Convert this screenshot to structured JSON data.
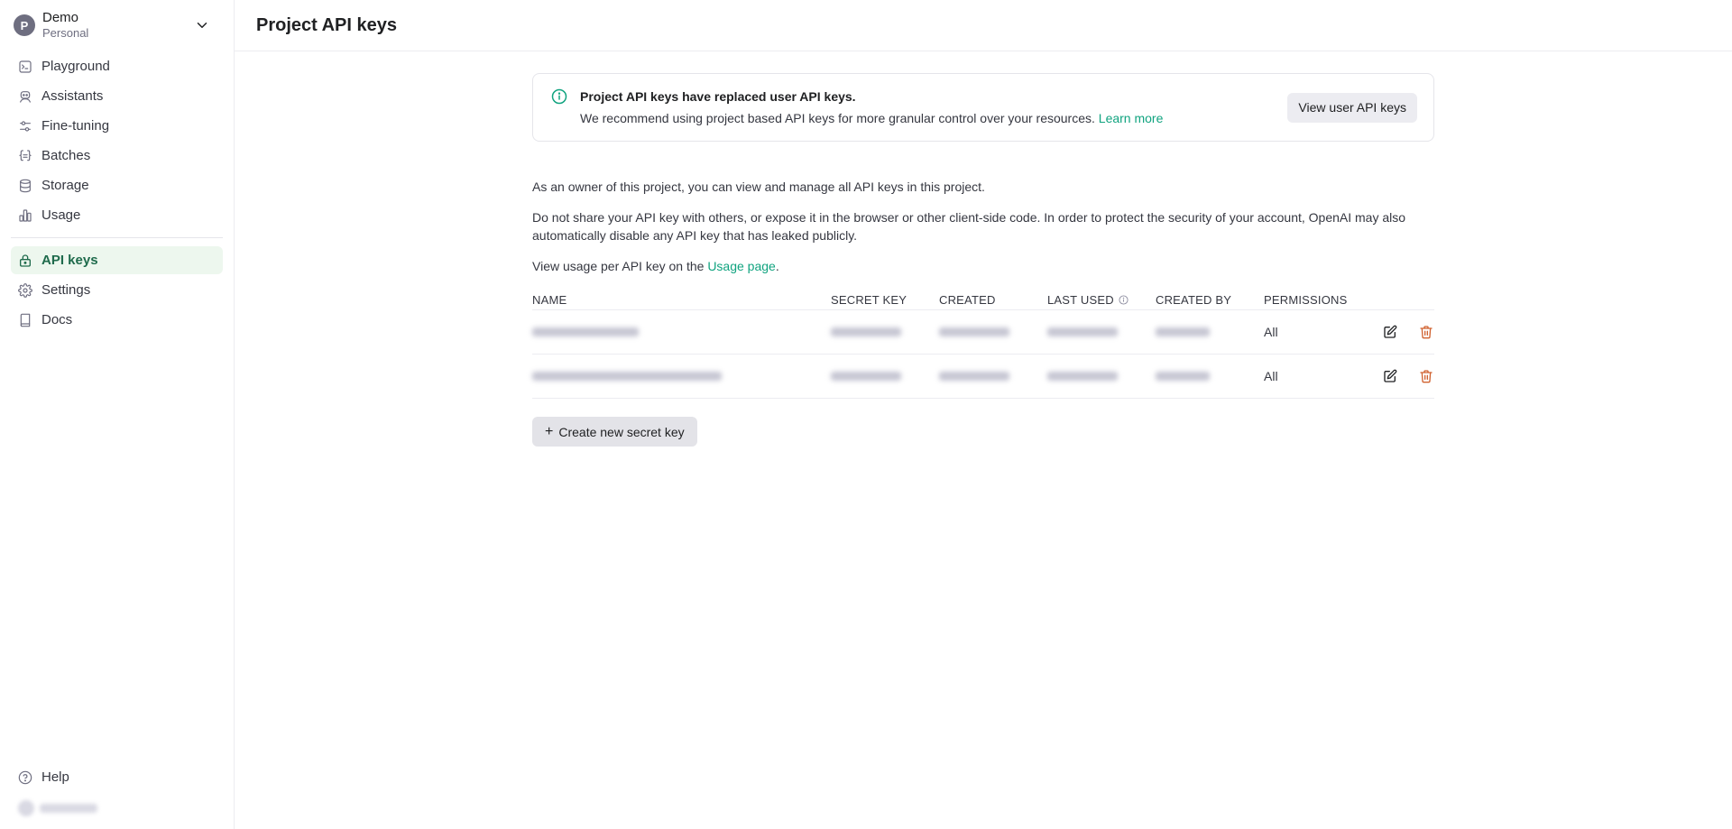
{
  "sidebar": {
    "org": {
      "avatar": "P",
      "name": "Demo",
      "sub": "Personal"
    },
    "items": [
      {
        "label": "Playground",
        "icon": "terminal-icon"
      },
      {
        "label": "Assistants",
        "icon": "robot-icon"
      },
      {
        "label": "Fine-tuning",
        "icon": "sliders-icon"
      },
      {
        "label": "Batches",
        "icon": "braces-icon"
      },
      {
        "label": "Storage",
        "icon": "database-icon"
      },
      {
        "label": "Usage",
        "icon": "bar-chart-icon"
      }
    ],
    "items2": [
      {
        "label": "API keys",
        "icon": "lock-icon",
        "active": true
      },
      {
        "label": "Settings",
        "icon": "gear-icon"
      },
      {
        "label": "Docs",
        "icon": "book-icon"
      }
    ],
    "help": "Help"
  },
  "header": {
    "title": "Project API keys"
  },
  "banner": {
    "title": "Project API keys have replaced user API keys.",
    "body": "We recommend using project based API keys for more granular control over your resources.",
    "link": "Learn more",
    "button": "View user API keys"
  },
  "info": {
    "p1": "As an owner of this project, you can view and manage all API keys in this project.",
    "p2": "Do not share your API key with others, or expose it in the browser or other client-side code. In order to protect the security of your account, OpenAI may also automatically disable any API key that has leaked publicly.",
    "p3_prefix": "View usage per API key on the",
    "p3_link": "Usage page",
    "p3_suffix": "."
  },
  "table": {
    "headers": {
      "name": "NAME",
      "secret_key": "SECRET KEY",
      "created": "CREATED",
      "last_used": "LAST USED",
      "created_by": "CREATED BY",
      "permissions": "PERMISSIONS"
    },
    "rows": [
      {
        "name": "",
        "secret_key": "",
        "created": "",
        "last_used": "",
        "created_by": "",
        "permissions": "All"
      },
      {
        "name": "",
        "secret_key": "",
        "created": "",
        "last_used": "",
        "created_by": "",
        "permissions": "All"
      }
    ]
  },
  "create_button": "Create new secret key",
  "colors": {
    "accent": "#10a37f",
    "active_bg": "#edf7ee",
    "danger": "#d0612f"
  }
}
